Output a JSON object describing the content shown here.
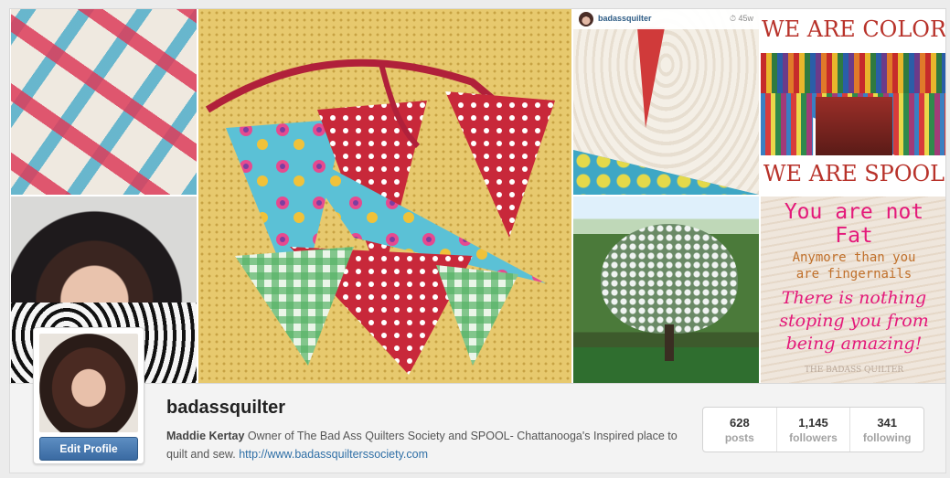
{
  "feed": {
    "photo_header": {
      "username": "badassquilter",
      "age": "45w"
    },
    "tile_color": {
      "line1": "WE ARE COLOR",
      "line2": "WE ARE SPOOL"
    },
    "tile_quote": {
      "line1": "You are not",
      "line2": "Fat",
      "line3": "Anymore than you",
      "line4": "are fingernails",
      "line5": "There is nothing",
      "line6": "stoping you from",
      "line7": "being amazing!",
      "line8": "THE BADASS QUILTER"
    }
  },
  "profile": {
    "username": "badassquilter",
    "edit_label": "Edit Profile",
    "full_name": "Maddie Kertay",
    "bio_text": " Owner of The Bad Ass Quilters Society and SPOOL- Chattanooga's Inspired place to quilt and sew. ",
    "website": "http://www.badassquilterssociety.com"
  },
  "stats": [
    {
      "value": "628",
      "label": "posts"
    },
    {
      "value": "1,145",
      "label": "followers"
    },
    {
      "value": "341",
      "label": "following"
    }
  ],
  "colors": {
    "link": "#2f6fa6",
    "button": "#3a6aa2",
    "accent_pink": "#e4197a",
    "accent_red": "#b8322a"
  }
}
